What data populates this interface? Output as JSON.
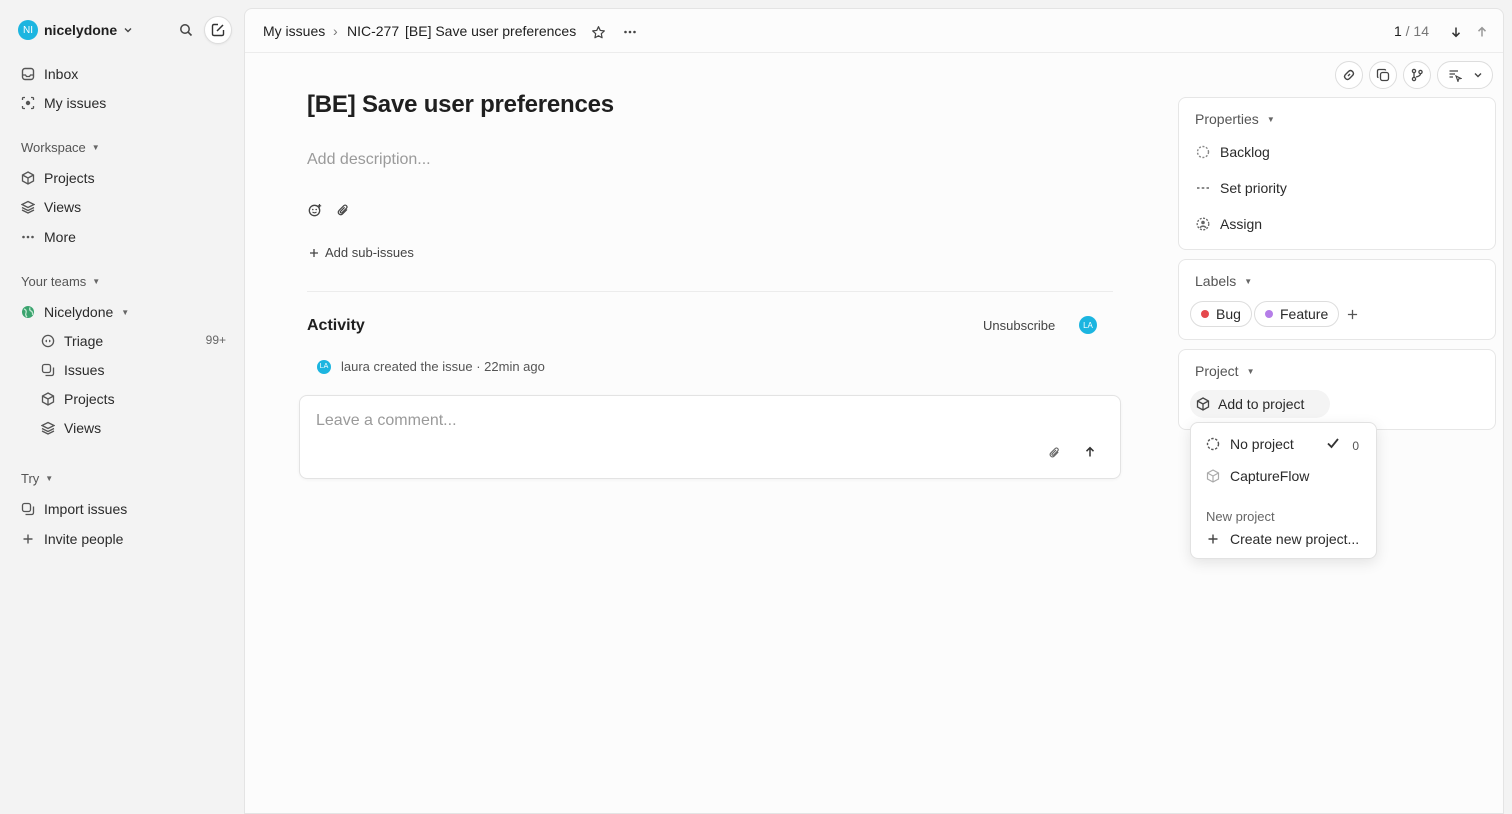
{
  "workspace": {
    "initials": "NI",
    "name": "nicelydone"
  },
  "nav": {
    "inbox": "Inbox",
    "my_issues": "My issues",
    "workspace_label": "Workspace",
    "projects": "Projects",
    "views": "Views",
    "more": "More",
    "your_teams_label": "Your teams",
    "team_name": "Nicelydone",
    "triage": "Triage",
    "triage_count": "99+",
    "issues": "Issues",
    "team_projects": "Projects",
    "team_views": "Views",
    "try_label": "Try",
    "import_issues": "Import issues",
    "invite_people": "Invite people"
  },
  "header": {
    "breadcrumb_root": "My issues",
    "separator": "›",
    "issue_id": "NIC-277",
    "issue_title": "[BE] Save user preferences",
    "pager_current": "1",
    "pager_total": "/ 14"
  },
  "issue": {
    "title": "[BE] Save user preferences",
    "description_placeholder": "Add description...",
    "add_sub_issues": "Add sub-issues"
  },
  "activity": {
    "title": "Activity",
    "unsubscribe": "Unsubscribe",
    "subscriber_initials": "LA",
    "event_initials": "LA",
    "event_user": "laura",
    "event_text": "created the issue",
    "event_dot": "·",
    "event_time": "22min ago",
    "comment_placeholder": "Leave a comment..."
  },
  "properties": {
    "heading": "Properties",
    "status": "Backlog",
    "priority": "Set priority",
    "assignee": "Assign"
  },
  "labels": {
    "heading": "Labels",
    "items": [
      {
        "name": "Bug",
        "color": "#e5484d"
      },
      {
        "name": "Feature",
        "color": "#b57ee8"
      }
    ]
  },
  "project": {
    "heading": "Project",
    "add_to_project": "Add to project",
    "dropdown": {
      "no_project": "No project",
      "no_project_count": "0",
      "option": "CaptureFlow",
      "section_label": "New project",
      "create_new": "Create new project..."
    }
  },
  "colors": {
    "accent": "#1cb5e0",
    "team_icon": "#3aa36e"
  }
}
